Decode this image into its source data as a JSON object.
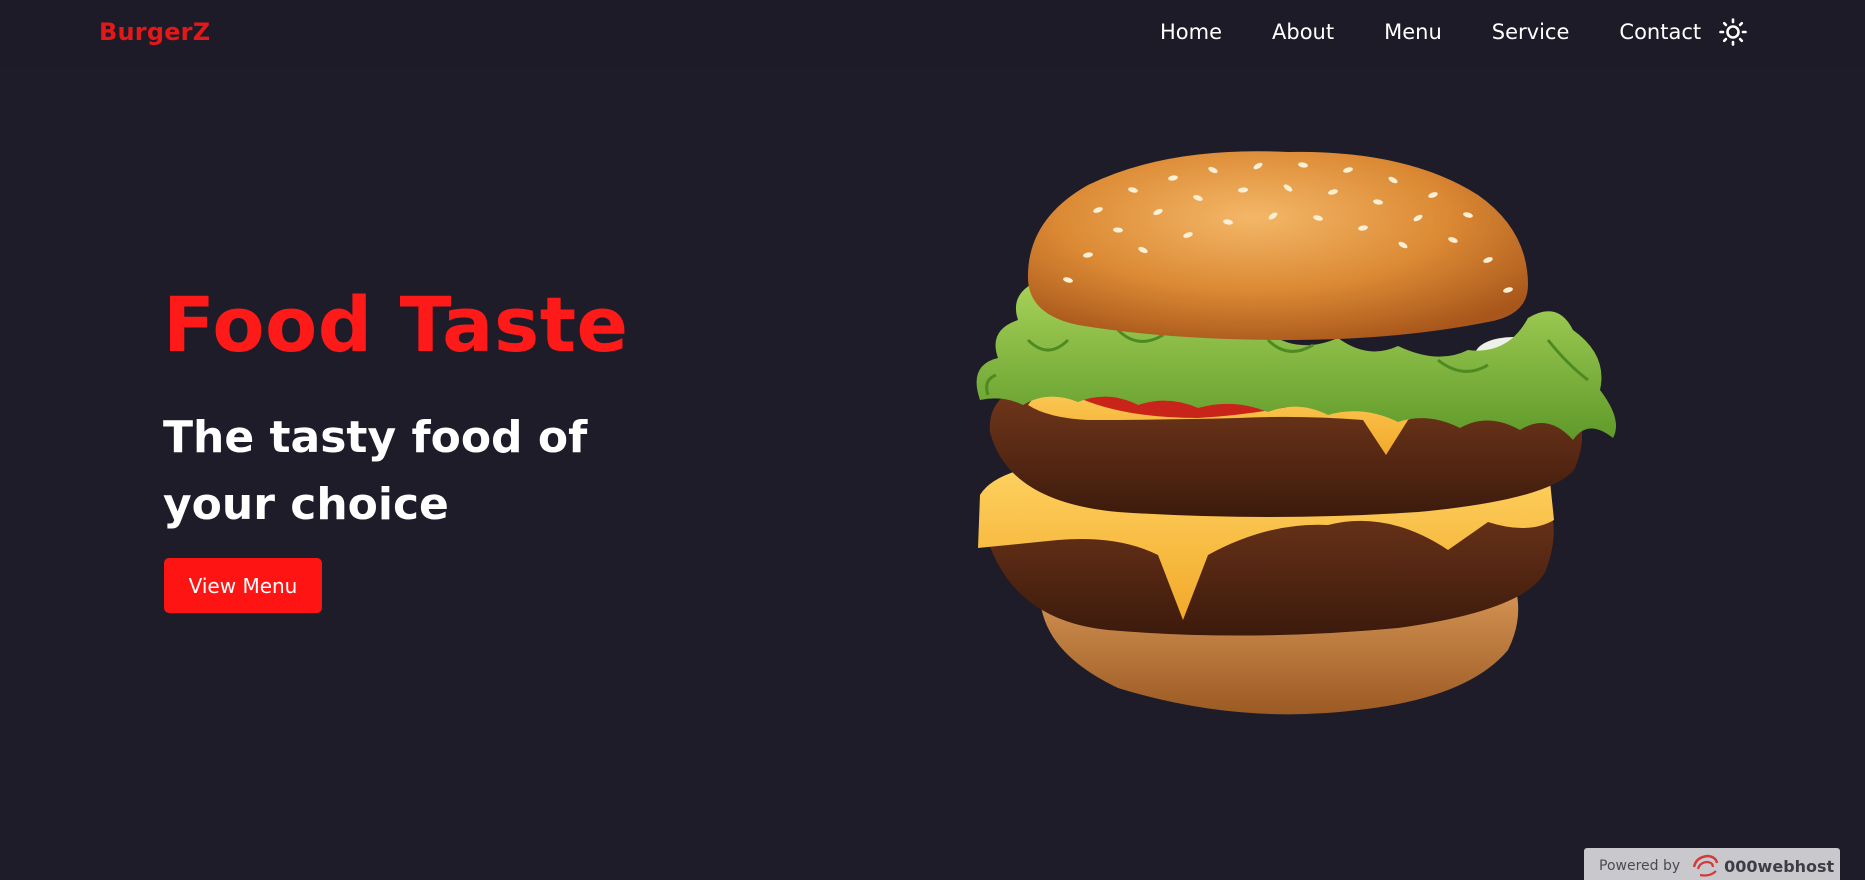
{
  "brand": "BurgerZ",
  "nav": {
    "items": [
      "Home",
      "About",
      "Menu",
      "Service",
      "Contact"
    ],
    "theme_toggle_icon": "sun-icon"
  },
  "hero": {
    "title": "Food Taste",
    "subtitle": "The tasty food of your choice",
    "cta_label": "View Menu",
    "image_alt": "double cheeseburger"
  },
  "colors": {
    "background": "#1e1c29",
    "accent": "#ff1a1a",
    "text": "#ffffff"
  },
  "badge": {
    "label": "Powered by",
    "brand": "000webhost",
    "icon": "000webhost-logo-icon"
  }
}
